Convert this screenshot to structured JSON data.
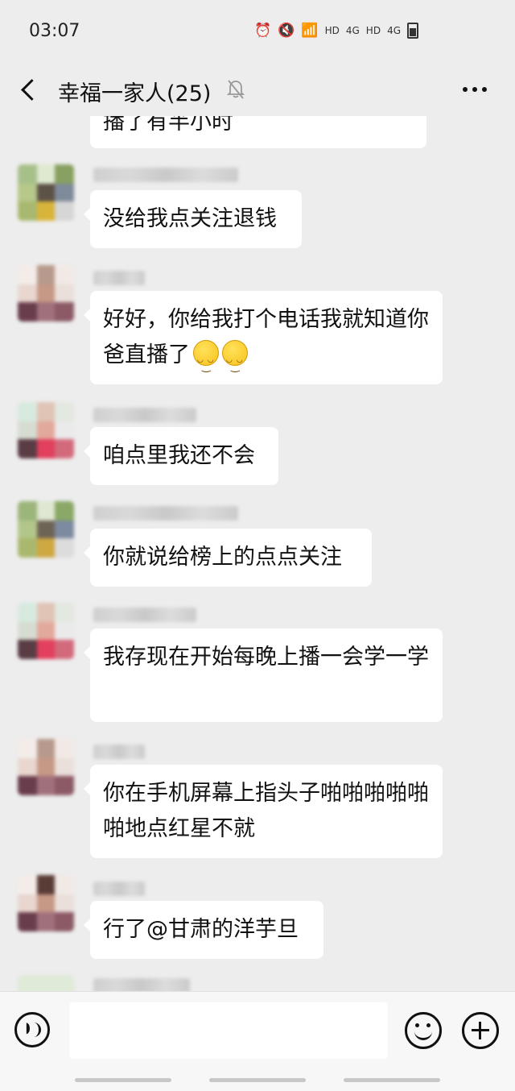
{
  "status_bar": {
    "time": "03:07",
    "icons": [
      "alarm-icon",
      "mute-icon",
      "wifi-icon",
      "hd-4g-signal-icon",
      "hd-4g-signal-icon",
      "battery-icon"
    ],
    "hd_label": "HD",
    "net_label": "4G"
  },
  "header": {
    "title": "幸福一家人(25)",
    "icons": [
      "back-icon",
      "mute-bell-icon",
      "more-icon"
    ]
  },
  "messages": [
    {
      "text": "播了有半小时",
      "partial": true
    },
    {
      "text": "没给我点关注退钱"
    },
    {
      "text": "好好，你给我打个电话我就知道你爸直播了",
      "emojis": 2
    },
    {
      "text": "咱点里我还不会"
    },
    {
      "text": "你就说给榜上的点点关注"
    },
    {
      "text": "我存现在开始每晚上播一会学一学"
    },
    {
      "text": "你在手机屏幕上指头子啪啪啪啪啪啪地点红星不就"
    },
    {
      "text": "行了@甘肃的洋芋旦"
    }
  ],
  "input_bar": {
    "icons": [
      "voice-icon",
      "emoji-icon",
      "plus-icon"
    ],
    "input_value": ""
  },
  "colors": {
    "background": "#ededed",
    "bubble": "#ffffff",
    "input_bar": "#f7f7f7"
  }
}
